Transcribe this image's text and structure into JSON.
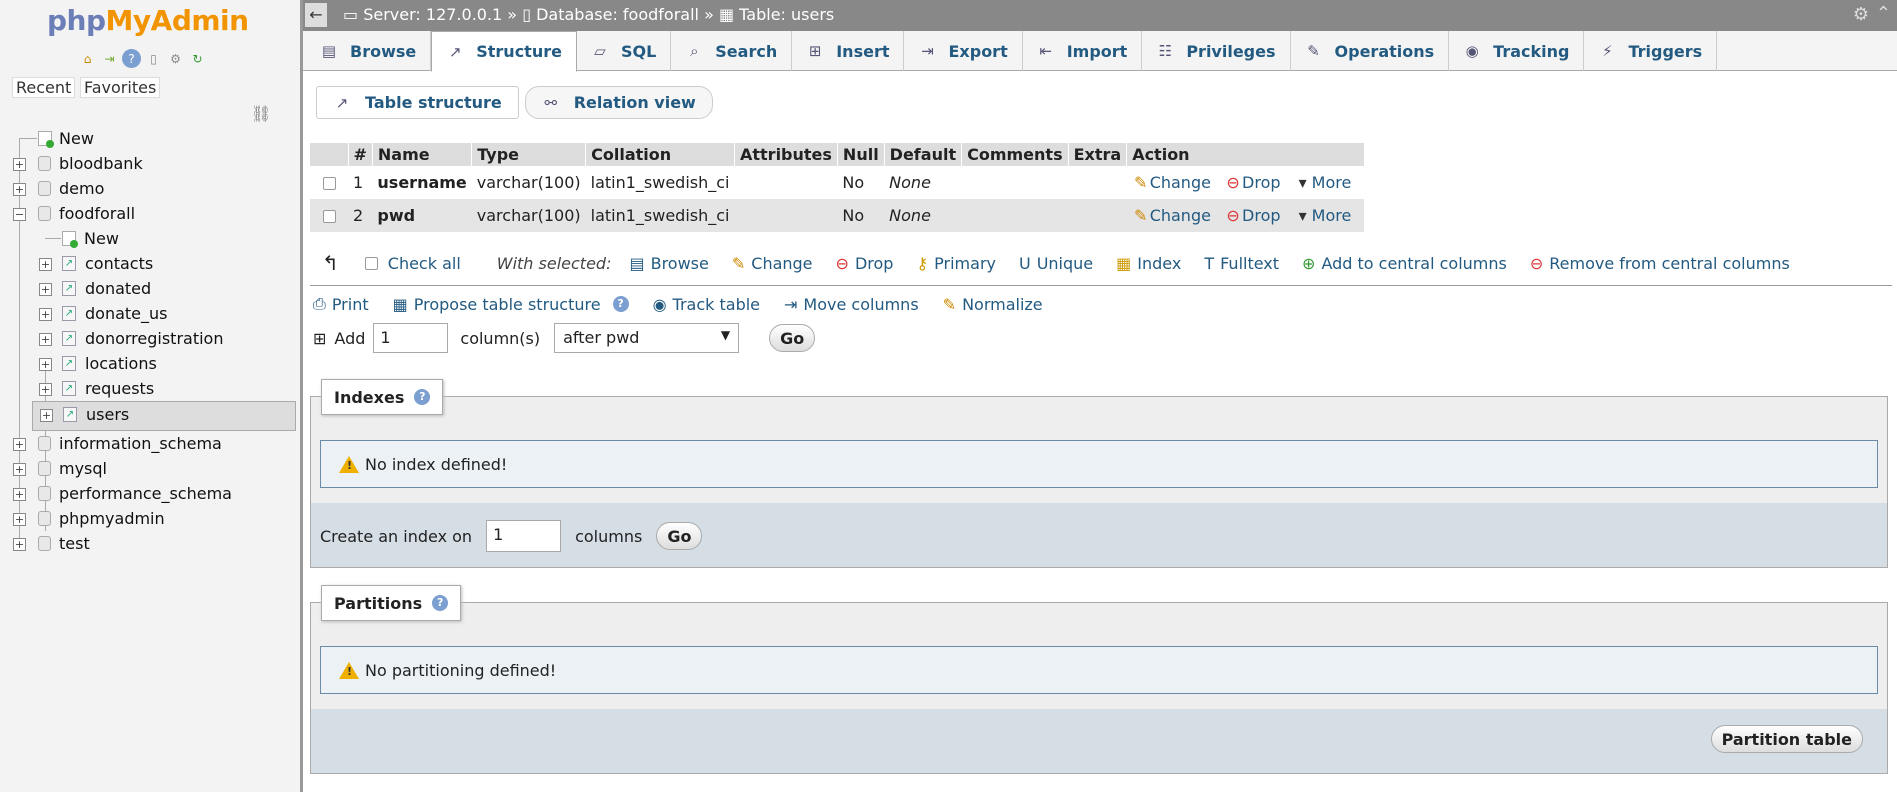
{
  "sidebar": {
    "logo": {
      "php": "php",
      "my": "MyAdmin"
    },
    "recent": "Recent",
    "favorites": "Favorites",
    "tree": [
      {
        "label": "New",
        "kind": "new",
        "level": 0
      },
      {
        "label": "bloodbank",
        "kind": "db",
        "level": 0
      },
      {
        "label": "demo",
        "kind": "db",
        "level": 0
      },
      {
        "label": "foodforall",
        "kind": "db",
        "level": 0,
        "expanded": true
      },
      {
        "label": "New",
        "kind": "new",
        "level": 1
      },
      {
        "label": "contacts",
        "kind": "table",
        "level": 1
      },
      {
        "label": "donated",
        "kind": "table",
        "level": 1
      },
      {
        "label": "donate_us",
        "kind": "table",
        "level": 1
      },
      {
        "label": "donorregistration",
        "kind": "table",
        "level": 1
      },
      {
        "label": "locations",
        "kind": "table",
        "level": 1
      },
      {
        "label": "requests",
        "kind": "table",
        "level": 1
      },
      {
        "label": "users",
        "kind": "table",
        "level": 1,
        "selected": true
      },
      {
        "label": "information_schema",
        "kind": "db",
        "level": 0
      },
      {
        "label": "mysql",
        "kind": "db",
        "level": 0
      },
      {
        "label": "performance_schema",
        "kind": "db",
        "level": 0
      },
      {
        "label": "phpmyadmin",
        "kind": "db",
        "level": 0
      },
      {
        "label": "test",
        "kind": "db",
        "level": 0
      }
    ]
  },
  "breadcrumb": {
    "server": "Server: 127.0.0.1",
    "sep1": " » ",
    "database": "Database: foodforall",
    "sep2": " » ",
    "table": "Table: users"
  },
  "tabs": [
    {
      "label": "Browse",
      "icon": "browse-icon"
    },
    {
      "label": "Structure",
      "icon": "structure-icon",
      "active": true
    },
    {
      "label": "SQL",
      "icon": "sql-icon"
    },
    {
      "label": "Search",
      "icon": "search-icon"
    },
    {
      "label": "Insert",
      "icon": "insert-icon"
    },
    {
      "label": "Export",
      "icon": "export-icon"
    },
    {
      "label": "Import",
      "icon": "import-icon"
    },
    {
      "label": "Privileges",
      "icon": "privileges-icon"
    },
    {
      "label": "Operations",
      "icon": "operations-icon"
    },
    {
      "label": "Tracking",
      "icon": "tracking-icon"
    },
    {
      "label": "Triggers",
      "icon": "triggers-icon"
    }
  ],
  "subtabs": {
    "table_structure": "Table structure",
    "relation_view": "Relation view"
  },
  "structure": {
    "headers": [
      "#",
      "Name",
      "Type",
      "Collation",
      "Attributes",
      "Null",
      "Default",
      "Comments",
      "Extra",
      "Action"
    ],
    "rows": [
      {
        "num": "1",
        "name": "username",
        "type": "varchar(100)",
        "collation": "latin1_swedish_ci",
        "attributes": "",
        "null": "No",
        "default": "None",
        "comments": "",
        "extra": ""
      },
      {
        "num": "2",
        "name": "pwd",
        "type": "varchar(100)",
        "collation": "latin1_swedish_ci",
        "attributes": "",
        "null": "No",
        "default": "None",
        "comments": "",
        "extra": ""
      }
    ],
    "actions": {
      "change": "Change",
      "drop": "Drop",
      "more": "More"
    }
  },
  "with_selected": {
    "check_all": "Check all",
    "label": "With selected:",
    "browse": "Browse",
    "change": "Change",
    "drop": "Drop",
    "primary": "Primary",
    "unique": "Unique",
    "index": "Index",
    "fulltext": "Fulltext",
    "add_central": "Add to central columns",
    "remove_central": "Remove from central columns"
  },
  "tools": {
    "print": "Print",
    "propose": "Propose table structure",
    "track": "Track table",
    "move": "Move columns",
    "normalize": "Normalize"
  },
  "add_columns": {
    "label": "Add",
    "count": "1",
    "unit": "column(s)",
    "position": "after pwd",
    "go": "Go"
  },
  "indexes": {
    "legend": "Indexes",
    "notice": "No index defined!",
    "create_label": "Create an index on",
    "count": "1",
    "unit": "columns",
    "go": "Go"
  },
  "partitions": {
    "legend": "Partitions",
    "notice": "No partitioning defined!",
    "button": "Partition table"
  }
}
